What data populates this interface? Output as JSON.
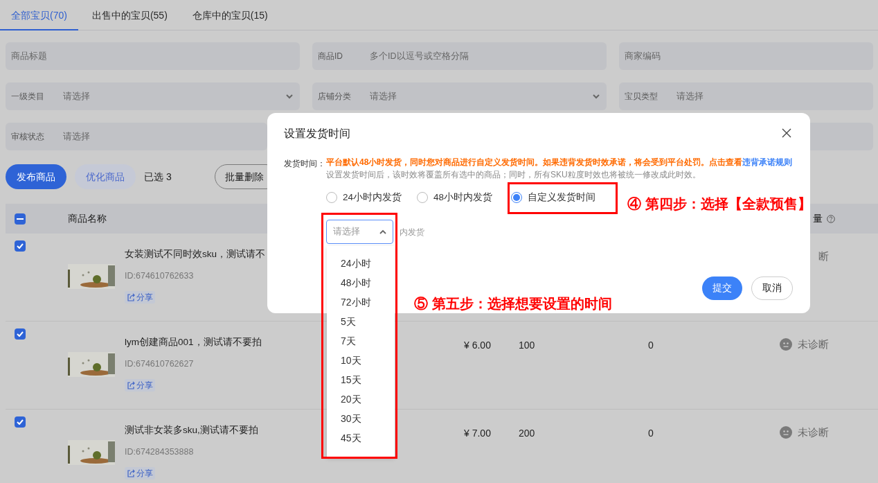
{
  "tabs": [
    {
      "label": "全部宝贝(70)",
      "selected": true
    },
    {
      "label": "出售中的宝贝(55)",
      "selected": false
    },
    {
      "label": "仓库中的宝贝(15)",
      "selected": false
    }
  ],
  "filters": [
    {
      "kind": "text",
      "placeholder": "商品标题"
    },
    {
      "kind": "text",
      "label": "商品ID",
      "placeholder": "多个ID以逗号或空格分隔"
    },
    {
      "kind": "text",
      "placeholder": "商家编码"
    },
    {
      "kind": "select",
      "label": "一级类目",
      "placeholder": "请选择"
    },
    {
      "kind": "select",
      "label": "店铺分类",
      "placeholder": "请选择"
    },
    {
      "kind": "text",
      "label": "宝贝类型",
      "placeholder": "请选择"
    },
    {
      "kind": "text",
      "label": "审核状态",
      "placeholder": "请选择"
    },
    {
      "kind": "covered"
    },
    {
      "kind": "empty"
    }
  ],
  "toolbar": {
    "buttons": [
      {
        "label": "发布商品",
        "kind": "primary"
      },
      {
        "label": "优化商品",
        "kind": "soft"
      }
    ],
    "selection": "已选 3",
    "batch_delete": "批量删除"
  },
  "table": {
    "header": {
      "select_all": true,
      "select_all_partial": true,
      "name_column": "商品名称",
      "cut_column": "量"
    },
    "rows": [
      {
        "checked": true,
        "title": "女装测试不同时效sku，测试请不",
        "id": "ID:674610762633",
        "share": "分享",
        "diagnosis": {
          "text": "断",
          "icon": false
        }
      },
      {
        "checked": true,
        "title": "lym创建商品001，测试请不要拍",
        "id": "ID:674610762627",
        "share": "分享",
        "price": "¥ 6.00",
        "stock": "100",
        "column_5": "0",
        "diagnosis": {
          "text": "未诊断",
          "icon": true
        }
      },
      {
        "checked": true,
        "title": "测试非女装多sku,测试请不要拍",
        "id": "ID:674284353888",
        "share": "分享",
        "price": "¥ 7.00",
        "stock": "200",
        "column_5": "0",
        "diagnosis": {
          "text": "未诊断",
          "icon": true
        }
      }
    ]
  },
  "dialog": {
    "title": "设置发货时间",
    "field_label": "发货时间：",
    "notice": "平台默认48小时发货，同时您对商品进行自定义发货时间。如果违背发货时效承诺，将会受到平台处罚。点击查看",
    "notice_link": "违背承诺规则",
    "hint": "设置发货时间后，该时效将覆盖所有选中的商品；同时，所有SKU粒度时效也将被统一修改成此时效。",
    "options": [
      {
        "label": "24小时内发货",
        "selected": false
      },
      {
        "label": "48小时内发货",
        "selected": false
      },
      {
        "label": "自定义发货时间",
        "selected": true
      }
    ],
    "select": {
      "placeholder": "请选择",
      "expanded": true
    },
    "suffix": "内发货",
    "menu": [
      "24小时",
      "48小时",
      "72小时",
      "5天",
      "7天",
      "10天",
      "15天",
      "20天",
      "30天",
      "45天"
    ],
    "buttons": [
      {
        "label": "提交",
        "kind": "primary"
      },
      {
        "label": "取消",
        "kind": "outline"
      }
    ]
  },
  "annotations": [
    "④ 第四步：选择【全款预售】",
    "⑤ 第五步：选择想要设置的时间"
  ]
}
